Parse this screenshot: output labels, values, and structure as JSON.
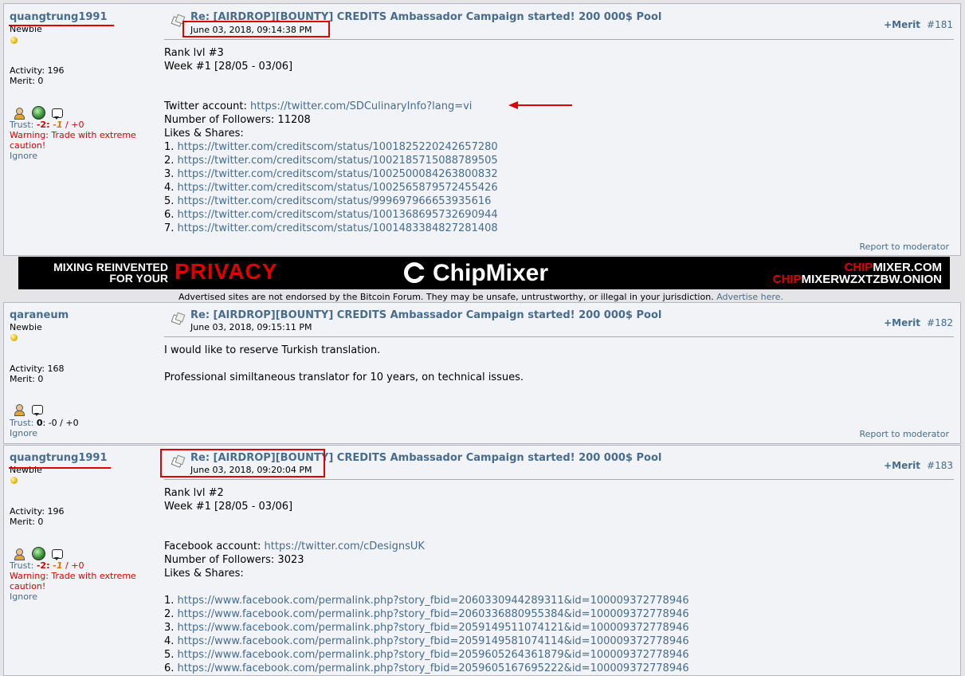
{
  "posts": [
    {
      "username": "quangtrung1991",
      "rank": "Newbie",
      "activity": "Activity: 196",
      "merit_stat": "Merit: 0",
      "trust_label": "Trust: ",
      "trust_neg": "-2",
      "trust_sep": ": ",
      "trust_neg2": "-1",
      "trust_rest": " / +0",
      "warning_1": "Warning: Trade with extreme",
      "warning_2": "caution!",
      "ignore": "Ignore",
      "subject": "Re: [AIRDROP][BOUNTY] CREDITS Ambassador Campaign started! 200 000$ Pool",
      "date": "June 03, 2018, 09:14:38 PM",
      "merit_button": "+Merit",
      "post_number": "#181",
      "lines": [
        {
          "text": "Rank lvl #3"
        },
        {
          "text": "Week #1 [28/05 - 03/06]"
        },
        {
          "text": "Twitter account: ",
          "link": "https://twitter.com/SDCulinaryInfo?lang=vi"
        },
        {
          "text": "Number of Followers: 11208"
        },
        {
          "text": "Likes & Shares:"
        },
        {
          "text": "1. ",
          "link": "https://twitter.com/creditscom/status/1001825220242657280"
        },
        {
          "text": "2. ",
          "link": "https://twitter.com/creditscom/status/1002185715088789505"
        },
        {
          "text": "3. ",
          "link": "https://twitter.com/creditscom/status/1002500084263800832"
        },
        {
          "text": "4. ",
          "link": "https://twitter.com/creditscom/status/1002565879572455426"
        },
        {
          "text": "5. ",
          "link": "https://twitter.com/creditscom/status/999697966653935616"
        },
        {
          "text": "6. ",
          "link": "https://twitter.com/creditscom/status/1001368695732690944"
        },
        {
          "text": "7. ",
          "link": "https://twitter.com/creditscom/status/1001483384827281408"
        }
      ],
      "report": "Report to moderator"
    },
    {
      "username": "qaraneum",
      "rank": "Newbie",
      "activity": "Activity: 168",
      "merit_stat": "Merit: 0",
      "trust_label": "Trust: ",
      "trust_zero": "0",
      "trust_rest": ": -0 / +0",
      "ignore": "Ignore",
      "subject": "Re: [AIRDROP][BOUNTY] CREDITS Ambassador Campaign started! 200 000$ Pool",
      "date": "June 03, 2018, 09:15:11 PM",
      "merit_button": "+Merit",
      "post_number": "#182",
      "lines": [
        {
          "text": "I would like to reserve Turkish translation."
        },
        {
          "text": "Professional similtaneous translator for 10 years, on technical issues."
        }
      ],
      "report": "Report to moderator"
    },
    {
      "username": "quangtrung1991",
      "rank": "Newbie",
      "activity": "Activity: 196",
      "merit_stat": "Merit: 0",
      "trust_label": "Trust: ",
      "trust_neg": "-2",
      "trust_sep": ": ",
      "trust_neg2": "-1",
      "trust_rest": " / +0",
      "warning_1": "Warning: Trade with extreme",
      "warning_2": "caution!",
      "ignore": "Ignore",
      "subject": "Re: [AIRDROP][BOUNTY] CREDITS Ambassador Campaign started! 200 000$ Pool",
      "date": "June 03, 2018, 09:20:04 PM",
      "merit_button": "+Merit",
      "post_number": "#183",
      "lines": [
        {
          "text": "Rank lvl #2"
        },
        {
          "text": "Week #1 [28/05 - 03/06]"
        },
        {
          "text": "Facebook account: ",
          "link": "https://twitter.com/cDesignsUK"
        },
        {
          "text": "Number of Followers: 3023"
        },
        {
          "text": "Likes & Shares:"
        },
        {
          "text": "1. ",
          "link": "https://www.facebook.com/permalink.php?story_fbid=2060330944289311&id=100009372778946"
        },
        {
          "text": "2. ",
          "link": "https://www.facebook.com/permalink.php?story_fbid=2060336880955384&id=100009372778946"
        },
        {
          "text": "3. ",
          "link": "https://www.facebook.com/permalink.php?story_fbid=2059149511074121&id=100009372778946"
        },
        {
          "text": "4. ",
          "link": "https://www.facebook.com/permalink.php?story_fbid=2059149581074114&id=100009372778946"
        },
        {
          "text": "5. ",
          "link": "https://www.facebook.com/permalink.php?story_fbid=2059605264361879&id=100009372778946"
        },
        {
          "text": "6. ",
          "link": "https://www.facebook.com/permalink.php?story_fbid=2059605167695222&id=100009372778946"
        }
      ]
    }
  ],
  "banner": {
    "left_line1": "MIXING REINVENTED",
    "left_line2": "FOR YOUR",
    "privacy": "PRIVACY",
    "logo_text": "ChipMixer",
    "domain1_a": "CHIP",
    "domain1_b": "MIXER",
    "domain1_c": ".COM",
    "domain2_a": "CHIP",
    "domain2_b": "MIXERWZXTZBW",
    "domain2_c": ".ONION"
  },
  "ad_notice": "Advertised sites are not endorsed by the Bitcoin Forum. They may be unsafe, untrustworthy, or illegal in your jurisdiction.",
  "ad_link": "Advertise here.",
  "colors": {
    "link": "#476C8E",
    "annotation_red": "#e00000",
    "post_bg": "#f1f3f6"
  }
}
